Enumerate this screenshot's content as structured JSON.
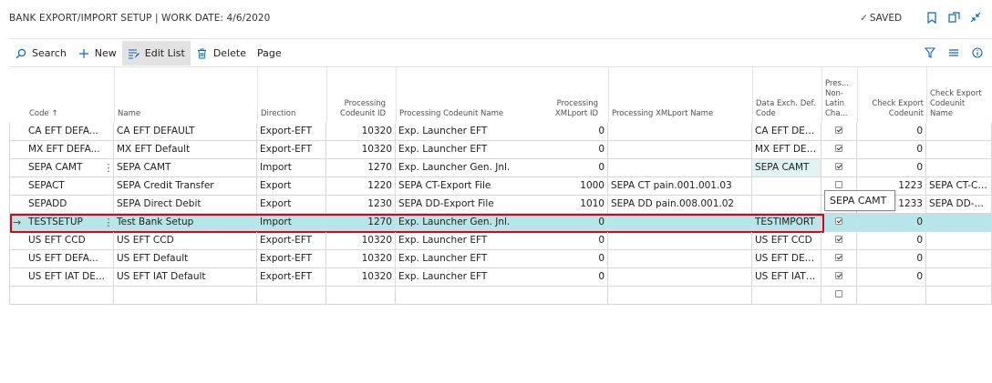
{
  "header": {
    "title": "BANK EXPORT/IMPORT SETUP | WORK DATE: 4/6/2020",
    "saved_label": "SAVED"
  },
  "actions": [
    {
      "label": "Search",
      "icon": "search-icon"
    },
    {
      "label": "New",
      "icon": "plus-icon"
    },
    {
      "label": "Edit List",
      "icon": "edit-list-icon"
    },
    {
      "label": "Delete",
      "icon": "trash-icon"
    },
    {
      "label": "Page",
      "icon": ""
    }
  ],
  "columns": [
    {
      "key": "code",
      "label": "Code ↑"
    },
    {
      "key": "name",
      "label": "Name"
    },
    {
      "key": "direction",
      "label": "Direction"
    },
    {
      "key": "proc_cu_id",
      "label": "Processing Codeunit ID"
    },
    {
      "key": "proc_cu_name",
      "label": "Processing Codeunit Name"
    },
    {
      "key": "proc_xml_id",
      "label": "Processing XMLport ID"
    },
    {
      "key": "proc_xml_name",
      "label": "Processing XMLport Name"
    },
    {
      "key": "data_exch",
      "label": "Data Exch. Def. Code"
    },
    {
      "key": "non_latin",
      "label": "Pres... Non-Latin Cha..."
    },
    {
      "key": "check_cu",
      "label": "Check Export Codeunit"
    },
    {
      "key": "check_cu_name",
      "label": "Check Export Codeunit Name"
    }
  ],
  "rows": [
    {
      "code": "CA EFT DEFA...",
      "name": "CA EFT DEFAULT",
      "direction": "Export-EFT",
      "proc_cu_id": "10320",
      "proc_cu_name": "Exp. Launcher EFT",
      "proc_xml_id": "0",
      "proc_xml_name": "",
      "data_exch": "CA EFT DEFA...",
      "non_latin": true,
      "check_cu": "0",
      "check_cu_name": ""
    },
    {
      "code": "MX EFT DEFA...",
      "name": "MX EFT Default",
      "direction": "Export-EFT",
      "proc_cu_id": "10320",
      "proc_cu_name": "Exp. Launcher EFT",
      "proc_xml_id": "0",
      "proc_xml_name": "",
      "data_exch": "MX EFT DEFA...",
      "non_latin": true,
      "check_cu": "0",
      "check_cu_name": ""
    },
    {
      "code": "SEPA CAMT",
      "name": "SEPA CAMT",
      "direction": "Import",
      "proc_cu_id": "1270",
      "proc_cu_name": "Exp. Launcher Gen. Jnl.",
      "proc_xml_id": "0",
      "proc_xml_name": "",
      "data_exch": "SEPA CAMT",
      "non_latin": true,
      "check_cu": "0",
      "check_cu_name": ""
    },
    {
      "code": "SEPACT",
      "name": "SEPA Credit Transfer",
      "direction": "Export",
      "proc_cu_id": "1220",
      "proc_cu_name": "SEPA CT-Export File",
      "proc_xml_id": "1000",
      "proc_xml_name": "SEPA CT pain.001.001.03",
      "data_exch": "",
      "non_latin": false,
      "check_cu": "1223",
      "check_cu_name": "SEPA CT-Chec"
    },
    {
      "code": "SEPADD",
      "name": "SEPA Direct Debit",
      "direction": "Export",
      "proc_cu_id": "1230",
      "proc_cu_name": "SEPA DD-Export File",
      "proc_xml_id": "1010",
      "proc_xml_name": "SEPA DD pain.008.001.02",
      "data_exch": "",
      "non_latin": false,
      "check_cu": "1233",
      "check_cu_name": "SEPA DD-Che"
    },
    {
      "code": "TESTSETUP",
      "name": "Test Bank Setup",
      "direction": "Import",
      "proc_cu_id": "1270",
      "proc_cu_name": "Exp. Launcher Gen. Jnl.",
      "proc_xml_id": "0",
      "proc_xml_name": "",
      "data_exch": "TESTIMPORT",
      "non_latin": true,
      "check_cu": "0",
      "check_cu_name": ""
    },
    {
      "code": "US EFT CCD",
      "name": "US EFT CCD",
      "direction": "Export-EFT",
      "proc_cu_id": "10320",
      "proc_cu_name": "Exp. Launcher EFT",
      "proc_xml_id": "0",
      "proc_xml_name": "",
      "data_exch": "US EFT CCD",
      "non_latin": true,
      "check_cu": "0",
      "check_cu_name": ""
    },
    {
      "code": "US EFT DEFA...",
      "name": "US EFT Default",
      "direction": "Export-EFT",
      "proc_cu_id": "10320",
      "proc_cu_name": "Exp. Launcher EFT",
      "proc_xml_id": "0",
      "proc_xml_name": "",
      "data_exch": "US EFT DEFA...",
      "non_latin": true,
      "check_cu": "0",
      "check_cu_name": ""
    },
    {
      "code": "US EFT IAT DE...",
      "name": "US EFT IAT Default",
      "direction": "Export-EFT",
      "proc_cu_id": "10320",
      "proc_cu_name": "Exp. Launcher EFT",
      "proc_xml_id": "0",
      "proc_xml_name": "",
      "data_exch": "US EFT IAT DE...",
      "non_latin": true,
      "check_cu": "0",
      "check_cu_name": ""
    },
    {
      "code": "",
      "name": "",
      "direction": "",
      "proc_cu_id": "",
      "proc_cu_name": "",
      "proc_xml_id": "",
      "proc_xml_name": "",
      "data_exch": "",
      "non_latin": false,
      "check_cu": "",
      "check_cu_name": ""
    }
  ],
  "selected_row": 5,
  "highlighted_cell": {
    "row": 2,
    "column": "data_exch"
  },
  "tooltip": "SEPA CAMT",
  "colors": {
    "accent": "#0a66c2",
    "selected_row": "#b7e6ea",
    "selection_border": "#e00012"
  }
}
